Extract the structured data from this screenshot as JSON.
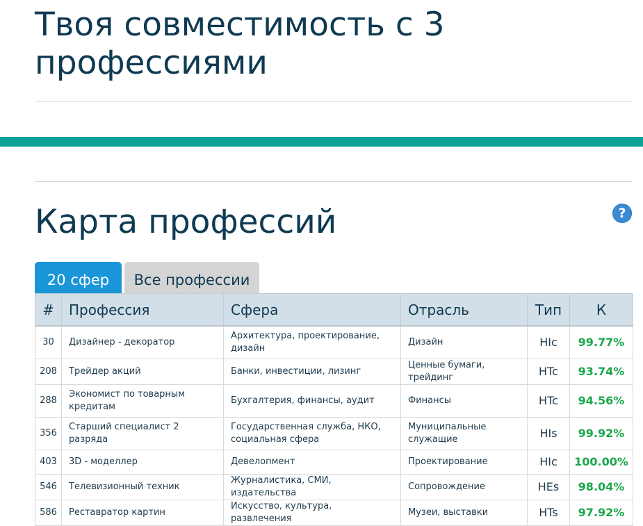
{
  "header": {
    "title": "Твоя совместимость с 3 профессиями"
  },
  "section": {
    "title": "Карта профессий",
    "help_glyph": "?"
  },
  "tabs": [
    {
      "label": "20 сфер",
      "active": true
    },
    {
      "label": "Все профессии",
      "active": false
    }
  ],
  "table": {
    "columns": [
      "#",
      "Профессия",
      "Сфера",
      "Отрасль",
      "Тип",
      "К"
    ],
    "rows": [
      {
        "num": "30",
        "profession": "Дизайнер - декоратор",
        "sphere": "Архитектура, проектирование, дизайн",
        "industry": "Дизайн",
        "type": "HIc",
        "k": "99.77%"
      },
      {
        "num": "208",
        "profession": "Трейдер акций",
        "sphere": "Банки, инвестиции, лизинг",
        "industry": "Ценные бумаги, трейдинг",
        "type": "HTc",
        "k": "93.74%"
      },
      {
        "num": "288",
        "profession": "Экономист по товарным кредитам",
        "sphere": "Бухгалтерия, финансы, аудит",
        "industry": "Финансы",
        "type": "HTc",
        "k": "94.56%"
      },
      {
        "num": "356",
        "profession": "Старший специалист 2 разряда",
        "sphere": "Государственная служба, НКО, социальная сфера",
        "industry": "Муниципальные служащие",
        "type": "HIs",
        "k": "99.92%"
      },
      {
        "num": "403",
        "profession": "3D - моделлер",
        "sphere": "Девелопмент",
        "industry": "Проектирование",
        "type": "HIc",
        "k": "100.00%"
      },
      {
        "num": "546",
        "profession": "Телевизионный техник",
        "sphere": "Журналистика, СМИ, издательства",
        "industry": "Сопровождение",
        "type": "HEs",
        "k": "98.04%"
      },
      {
        "num": "586",
        "profession": "Реставратор картин",
        "sphere": "Искусство, культура, развлечения",
        "industry": "Музеи, выставки",
        "type": "HTs",
        "k": "97.92%"
      }
    ]
  },
  "colors": {
    "accent_teal": "#0ca39a",
    "tab_active": "#1a96d8",
    "score_green": "#1aa84b",
    "help_blue": "#3a8ad4"
  }
}
